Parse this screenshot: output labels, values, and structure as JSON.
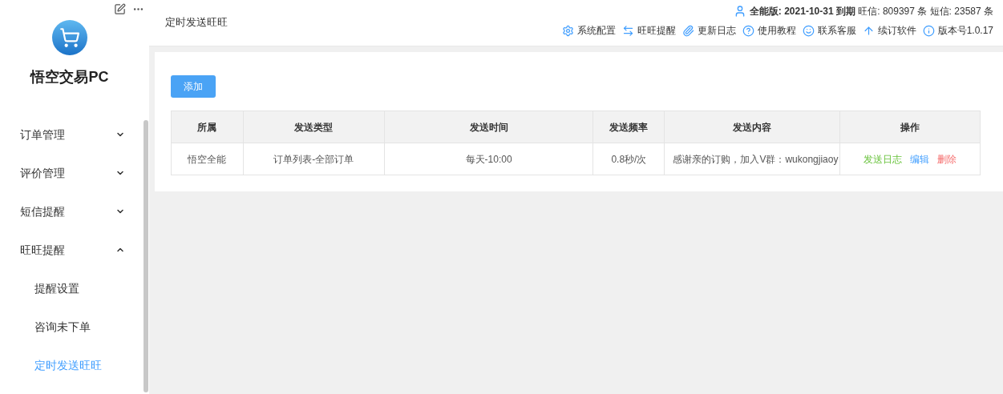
{
  "sidebar": {
    "app_name": "悟空交易PC",
    "menu": [
      {
        "label": "订单管理",
        "expanded": false
      },
      {
        "label": "评价管理",
        "expanded": false
      },
      {
        "label": "短信提醒",
        "expanded": false
      },
      {
        "label": "旺旺提醒",
        "expanded": true,
        "children": [
          {
            "label": "提醒设置",
            "selected": false
          },
          {
            "label": "咨询未下单",
            "selected": false
          },
          {
            "label": "定时发送旺旺",
            "selected": true
          }
        ]
      }
    ]
  },
  "header": {
    "breadcrumb": "定时发送旺旺",
    "account_info": "**全能版: 2021-10-31 到期** 旺信: 809397 条 短信: 23587 条",
    "toolbar": [
      {
        "kind": "settings",
        "label": "系统配置"
      },
      {
        "kind": "swap",
        "label": "旺旺提醒"
      },
      {
        "kind": "clip",
        "label": "更新日志"
      },
      {
        "kind": "help",
        "label": "使用教程"
      },
      {
        "kind": "service",
        "label": "联系客服"
      },
      {
        "kind": "renew",
        "label": "续订软件"
      },
      {
        "kind": "info",
        "label": "版本号1.0.17"
      }
    ]
  },
  "add_button": "添加",
  "table": {
    "columns": [
      "所属",
      "发送类型",
      "发送时间",
      "发送频率",
      "发送内容",
      "操作"
    ],
    "rows": [
      {
        "cells": [
          "悟空全能",
          "订单列表-全部订单",
          "每天-10:00",
          "0.8秒/次",
          "感谢亲的订购，加入V群：wukongjiaoy"
        ],
        "actions": [
          {
            "label": "发送日志",
            "kind": "log"
          },
          {
            "label": "编辑",
            "kind": "edit"
          },
          {
            "label": "删除",
            "kind": "delete"
          }
        ]
      }
    ]
  }
}
